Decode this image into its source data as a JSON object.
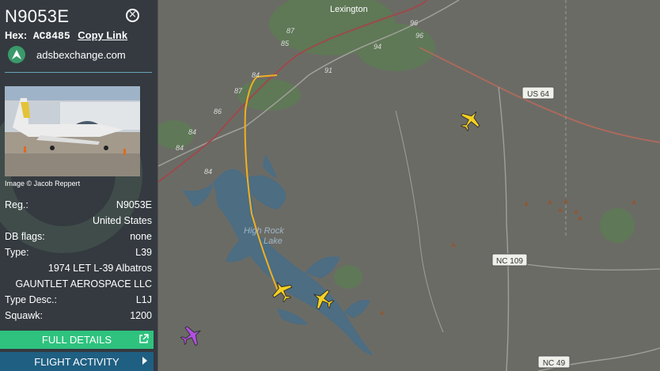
{
  "aircraft": {
    "registration": "N9053E",
    "hex_label": "Hex:",
    "hex": "AC8485",
    "copy_link": "Copy Link",
    "source": "adsbexchange.com",
    "image_credit": "Image © Jacob Reppert"
  },
  "details": [
    {
      "label": "Reg.:",
      "value": "N9053E"
    },
    {
      "label": "",
      "value": "United States"
    },
    {
      "label": "DB flags:",
      "value": "none"
    },
    {
      "label": "Type:",
      "value": "L39"
    },
    {
      "label": "",
      "value": "1974 LET L-39 Albatros"
    },
    {
      "label": "",
      "value": "GAUNTLET AEROSPACE LLC"
    },
    {
      "label": "Type Desc.:",
      "value": "L1J"
    },
    {
      "label": "Squawk:",
      "value": "1200"
    }
  ],
  "buttons": {
    "full_details": "FULL DETAILS",
    "flight_activity": "FLIGHT ACTIVITY"
  },
  "map": {
    "city": "Lexington",
    "lake": [
      "High Rock",
      "Lake"
    ],
    "road_shields": [
      "US 64",
      "NC 109",
      "NC 49"
    ],
    "route_numbers": [
      "96",
      "96",
      "94",
      "91",
      "85",
      "87",
      "84",
      "87",
      "86",
      "84",
      "84",
      "84"
    ],
    "colors": {
      "background": "#6b6b66",
      "water": "#4c6d82",
      "track": "#f0b020",
      "selected_plane": "#f5d020",
      "other_plane": "#b050e0"
    }
  }
}
